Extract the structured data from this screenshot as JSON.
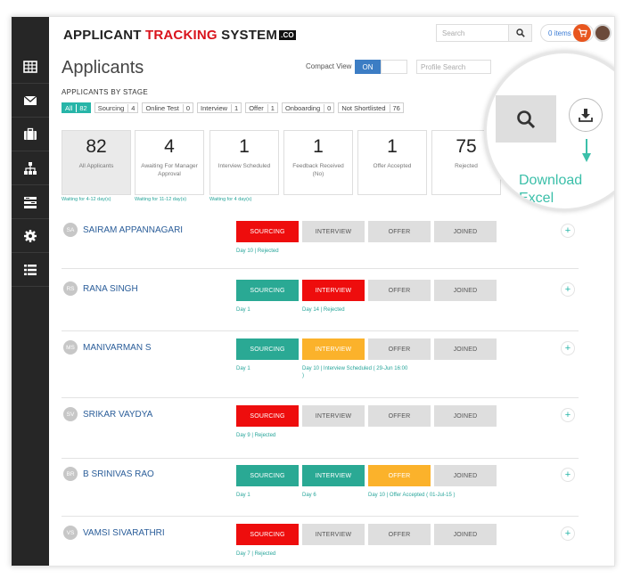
{
  "app": {
    "logo": {
      "part1": "APPLICANT ",
      "part2": "TRACKING",
      "part3": " SYSTEM",
      "badge": ".CO"
    },
    "search_placeholder": "Search",
    "items_label": "0 items",
    "accent": "#27b5a8",
    "brand_red": "#d9131c"
  },
  "sidebar": [
    {
      "icon": "grid-icon"
    },
    {
      "icon": "envelope-icon"
    },
    {
      "icon": "briefcase-icon"
    },
    {
      "icon": "org-chart-icon"
    },
    {
      "icon": "list-panel-icon"
    },
    {
      "icon": "gear-icon"
    },
    {
      "icon": "list-icon"
    }
  ],
  "page": {
    "title": "Applicants",
    "compact_view_label": "Compact View",
    "compact_view_state": "ON",
    "profile_search_placeholder": "Profile Search"
  },
  "stages": {
    "heading": "APPLICANTS BY STAGE",
    "items": [
      {
        "label": "All",
        "count": "82"
      },
      {
        "label": "Sourcing",
        "count": "4"
      },
      {
        "label": "Online Test",
        "count": "0"
      },
      {
        "label": "Interview",
        "count": "1"
      },
      {
        "label": "Offer",
        "count": "1"
      },
      {
        "label": "Onboarding",
        "count": "0"
      },
      {
        "label": "Not Shortlisted",
        "count": "76"
      }
    ]
  },
  "stats": [
    {
      "value": "82",
      "label": "All Applicants",
      "footer": "Waiting for 4-12 day(s)"
    },
    {
      "value": "4",
      "label": "Awaiting For Manager Approval",
      "footer": "Waiting for 11-12 day(s)"
    },
    {
      "value": "1",
      "label": "Interview Scheduled",
      "footer": "Waiting for 4 day(s)"
    },
    {
      "value": "1",
      "label": "Feedback Received (No)",
      "footer": ""
    },
    {
      "value": "1",
      "label": "Offer Accepted",
      "footer": ""
    },
    {
      "value": "75",
      "label": "Rejected",
      "footer": ""
    }
  ],
  "stage_columns": [
    "SOURCING",
    "INTERVIEW",
    "OFFER",
    "JOINED"
  ],
  "candidates": [
    {
      "initials": "SA",
      "name": "SAIRAM APPANNAGARI",
      "stage_colors": [
        "red",
        "gray",
        "gray",
        "gray"
      ],
      "notes": [
        "Day 10 | Rejected",
        "",
        "",
        ""
      ]
    },
    {
      "initials": "RS",
      "name": "RANA SINGH",
      "stage_colors": [
        "teal",
        "red",
        "gray",
        "gray"
      ],
      "notes": [
        "Day 1",
        "Day 14 | Rejected",
        "",
        ""
      ]
    },
    {
      "initials": "MS",
      "name": "MANIVARMAN S",
      "stage_colors": [
        "teal",
        "amber",
        "gray",
        "gray"
      ],
      "notes": [
        "Day 1",
        "Day 10 | Interview Scheduled ( 29-Jun 16:00 )",
        "",
        ""
      ]
    },
    {
      "initials": "SV",
      "name": "SRIKAR VAYDYA",
      "stage_colors": [
        "red",
        "gray",
        "gray",
        "gray"
      ],
      "notes": [
        "Day 9 | Rejected",
        "",
        "",
        ""
      ]
    },
    {
      "initials": "BR",
      "name": "B SRINIVAS RAO",
      "stage_colors": [
        "teal",
        "teal",
        "amber",
        "gray"
      ],
      "notes": [
        "Day 1",
        "Day 6",
        "Day 10 | Offer Accepted ( 01-Jul-15 )",
        ""
      ]
    },
    {
      "initials": "VS",
      "name": "VAMSI SIVARATHRI",
      "stage_colors": [
        "red",
        "gray",
        "gray",
        "gray"
      ],
      "notes": [
        "Day 7 | Rejected",
        "",
        "",
        ""
      ]
    }
  ],
  "magnifier": {
    "download_text": "Download Excel"
  }
}
